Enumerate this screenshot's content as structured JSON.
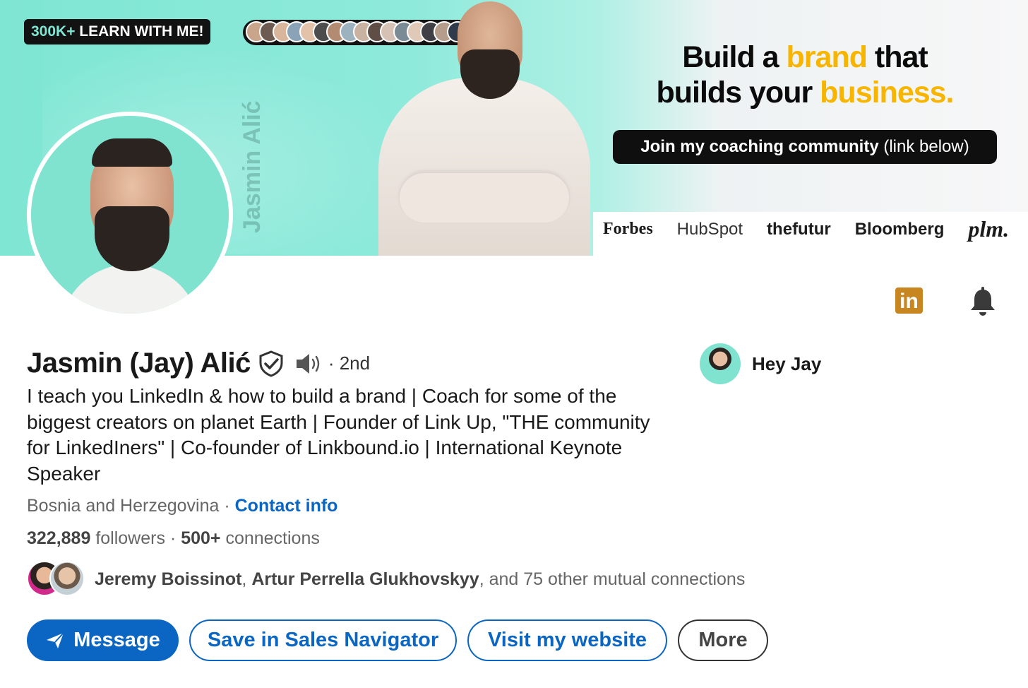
{
  "banner": {
    "badge_prefix": "300K+",
    "badge_rest": " LEARN WITH ME!",
    "ghost_name": "Jasmin Alić",
    "headline_line1_a": "Build a ",
    "headline_line1_b": "brand",
    "headline_line1_c": " that",
    "headline_line2_a": "builds your ",
    "headline_line2_b": "business.",
    "cta_bold": "Join my coaching community",
    "cta_rest": " (link below)",
    "press_logos": [
      "Forbes",
      "HubSpot",
      "thefutur",
      "Bloomberg",
      "plm."
    ],
    "accent_color": "#f7b500",
    "teal_color": "#7fe6d3"
  },
  "profile": {
    "name": "Jasmin (Jay) Alić",
    "degree": "· 2nd",
    "headline": "I teach you LinkedIn & how to build a brand | Coach for some of the biggest creators on planet Earth | Founder of Link Up, \"THE community for LinkedIners\" | Co-founder of Linkbound.io | International Keynote Speaker",
    "location": "Bosnia and Herzegovina",
    "location_sep": " · ",
    "contact_info": "Contact info",
    "followers_count": "322,889",
    "followers_label": " followers",
    "stat_sep": "  · ",
    "connections_count": "500+",
    "connections_label": " connections",
    "mutual_name1": "Jeremy Boissinot",
    "mutual_comma": ", ",
    "mutual_name2": "Artur Perrella Glukhovskyy",
    "mutual_rest": ", and 75 other mutual connections",
    "linkedin_badge": "in"
  },
  "aside": {
    "greeting": "Hey Jay"
  },
  "actions": {
    "message": "Message",
    "save_sales_nav": "Save in Sales Navigator",
    "visit_website": "Visit my website",
    "more": "More"
  },
  "colors": {
    "link_blue": "#0a66c2",
    "linkedin_badge": "#c7861f"
  }
}
